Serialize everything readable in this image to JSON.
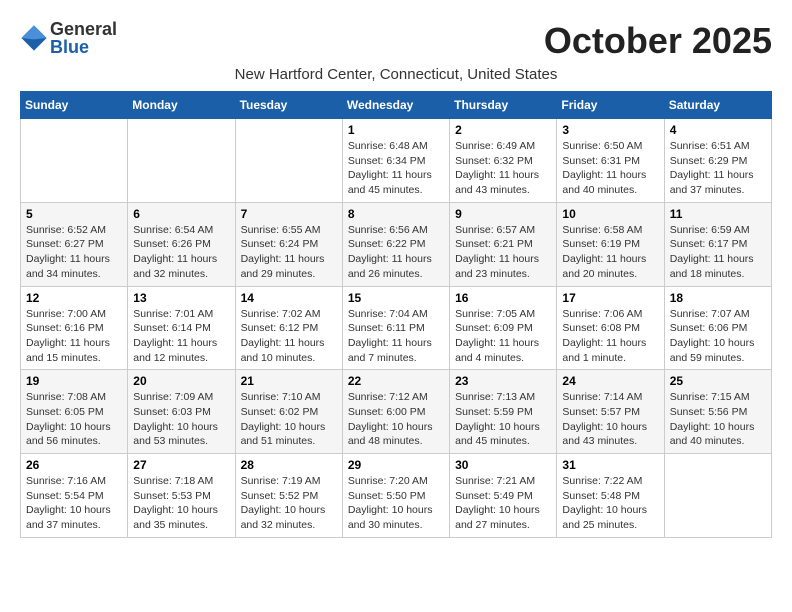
{
  "header": {
    "logo_general": "General",
    "logo_blue": "Blue",
    "month_title": "October 2025",
    "location": "New Hartford Center, Connecticut, United States"
  },
  "days_of_week": [
    "Sunday",
    "Monday",
    "Tuesday",
    "Wednesday",
    "Thursday",
    "Friday",
    "Saturday"
  ],
  "weeks": [
    [
      {
        "day": "",
        "info": ""
      },
      {
        "day": "",
        "info": ""
      },
      {
        "day": "",
        "info": ""
      },
      {
        "day": "1",
        "info": "Sunrise: 6:48 AM\nSunset: 6:34 PM\nDaylight: 11 hours and 45 minutes."
      },
      {
        "day": "2",
        "info": "Sunrise: 6:49 AM\nSunset: 6:32 PM\nDaylight: 11 hours and 43 minutes."
      },
      {
        "day": "3",
        "info": "Sunrise: 6:50 AM\nSunset: 6:31 PM\nDaylight: 11 hours and 40 minutes."
      },
      {
        "day": "4",
        "info": "Sunrise: 6:51 AM\nSunset: 6:29 PM\nDaylight: 11 hours and 37 minutes."
      }
    ],
    [
      {
        "day": "5",
        "info": "Sunrise: 6:52 AM\nSunset: 6:27 PM\nDaylight: 11 hours and 34 minutes."
      },
      {
        "day": "6",
        "info": "Sunrise: 6:54 AM\nSunset: 6:26 PM\nDaylight: 11 hours and 32 minutes."
      },
      {
        "day": "7",
        "info": "Sunrise: 6:55 AM\nSunset: 6:24 PM\nDaylight: 11 hours and 29 minutes."
      },
      {
        "day": "8",
        "info": "Sunrise: 6:56 AM\nSunset: 6:22 PM\nDaylight: 11 hours and 26 minutes."
      },
      {
        "day": "9",
        "info": "Sunrise: 6:57 AM\nSunset: 6:21 PM\nDaylight: 11 hours and 23 minutes."
      },
      {
        "day": "10",
        "info": "Sunrise: 6:58 AM\nSunset: 6:19 PM\nDaylight: 11 hours and 20 minutes."
      },
      {
        "day": "11",
        "info": "Sunrise: 6:59 AM\nSunset: 6:17 PM\nDaylight: 11 hours and 18 minutes."
      }
    ],
    [
      {
        "day": "12",
        "info": "Sunrise: 7:00 AM\nSunset: 6:16 PM\nDaylight: 11 hours and 15 minutes."
      },
      {
        "day": "13",
        "info": "Sunrise: 7:01 AM\nSunset: 6:14 PM\nDaylight: 11 hours and 12 minutes."
      },
      {
        "day": "14",
        "info": "Sunrise: 7:02 AM\nSunset: 6:12 PM\nDaylight: 11 hours and 10 minutes."
      },
      {
        "day": "15",
        "info": "Sunrise: 7:04 AM\nSunset: 6:11 PM\nDaylight: 11 hours and 7 minutes."
      },
      {
        "day": "16",
        "info": "Sunrise: 7:05 AM\nSunset: 6:09 PM\nDaylight: 11 hours and 4 minutes."
      },
      {
        "day": "17",
        "info": "Sunrise: 7:06 AM\nSunset: 6:08 PM\nDaylight: 11 hours and 1 minute."
      },
      {
        "day": "18",
        "info": "Sunrise: 7:07 AM\nSunset: 6:06 PM\nDaylight: 10 hours and 59 minutes."
      }
    ],
    [
      {
        "day": "19",
        "info": "Sunrise: 7:08 AM\nSunset: 6:05 PM\nDaylight: 10 hours and 56 minutes."
      },
      {
        "day": "20",
        "info": "Sunrise: 7:09 AM\nSunset: 6:03 PM\nDaylight: 10 hours and 53 minutes."
      },
      {
        "day": "21",
        "info": "Sunrise: 7:10 AM\nSunset: 6:02 PM\nDaylight: 10 hours and 51 minutes."
      },
      {
        "day": "22",
        "info": "Sunrise: 7:12 AM\nSunset: 6:00 PM\nDaylight: 10 hours and 48 minutes."
      },
      {
        "day": "23",
        "info": "Sunrise: 7:13 AM\nSunset: 5:59 PM\nDaylight: 10 hours and 45 minutes."
      },
      {
        "day": "24",
        "info": "Sunrise: 7:14 AM\nSunset: 5:57 PM\nDaylight: 10 hours and 43 minutes."
      },
      {
        "day": "25",
        "info": "Sunrise: 7:15 AM\nSunset: 5:56 PM\nDaylight: 10 hours and 40 minutes."
      }
    ],
    [
      {
        "day": "26",
        "info": "Sunrise: 7:16 AM\nSunset: 5:54 PM\nDaylight: 10 hours and 37 minutes."
      },
      {
        "day": "27",
        "info": "Sunrise: 7:18 AM\nSunset: 5:53 PM\nDaylight: 10 hours and 35 minutes."
      },
      {
        "day": "28",
        "info": "Sunrise: 7:19 AM\nSunset: 5:52 PM\nDaylight: 10 hours and 32 minutes."
      },
      {
        "day": "29",
        "info": "Sunrise: 7:20 AM\nSunset: 5:50 PM\nDaylight: 10 hours and 30 minutes."
      },
      {
        "day": "30",
        "info": "Sunrise: 7:21 AM\nSunset: 5:49 PM\nDaylight: 10 hours and 27 minutes."
      },
      {
        "day": "31",
        "info": "Sunrise: 7:22 AM\nSunset: 5:48 PM\nDaylight: 10 hours and 25 minutes."
      },
      {
        "day": "",
        "info": ""
      }
    ]
  ]
}
